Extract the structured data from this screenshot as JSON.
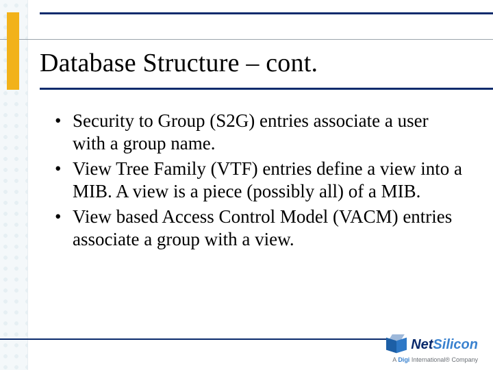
{
  "colors": {
    "rule": "#0a2a6c",
    "gold": "#f2b21a",
    "logo_primary": "#0a2a6c",
    "logo_secondary": "#3a82cf"
  },
  "title": "Database Structure – cont.",
  "bullets": [
    "Security to Group (S2G) entries associate a user with a group name.",
    "View Tree Family (VTF) entries define a view into a MIB.  A view is a piece (possibly all) of a MIB.",
    "View based Access Control Model (VACM) entries associate a group with a view."
  ],
  "logo": {
    "brand_a": "Net",
    "brand_b": "Silicon",
    "tag_prefix": "A ",
    "tag_brand": "Digi",
    "tag_suffix": " International® Company"
  }
}
